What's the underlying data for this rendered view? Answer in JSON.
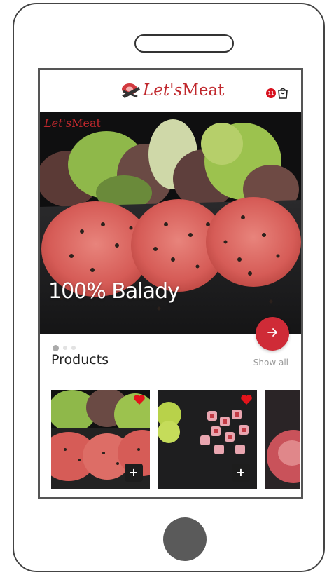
{
  "app": {
    "brand_lets": "Let's",
    "brand_meat": "Meat",
    "cart_count": "11"
  },
  "hero": {
    "brand_lets": "Let's",
    "brand_meat": "Meat",
    "title": "100% Balady",
    "slides_total": 3,
    "slide_active": 1
  },
  "products": {
    "title": "Products",
    "show_all": "Show all",
    "items": [
      {
        "image": "burger-patties",
        "add_label": "+"
      },
      {
        "image": "sausage-pieces",
        "add_label": "+"
      },
      {
        "image": "raw-meat",
        "add_label": "+"
      }
    ]
  },
  "colors": {
    "brand_red": "#c0282d",
    "accent_button": "#cf2b37",
    "badge": "#d8121f"
  },
  "icons": [
    "logo-steer-icon",
    "cart-bag-icon",
    "arrow-right-icon",
    "heart-icon",
    "plus-icon"
  ]
}
